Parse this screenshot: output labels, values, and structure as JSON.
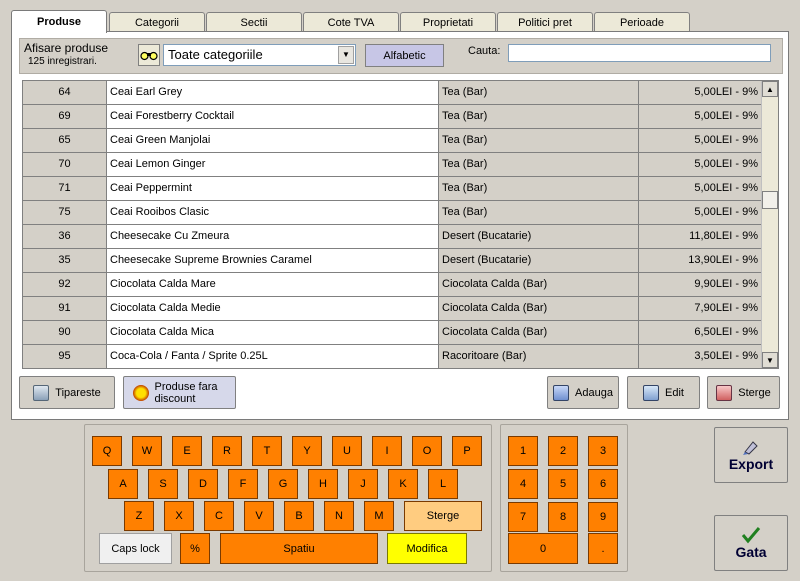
{
  "tabs": [
    "Produse",
    "Categorii",
    "Sectii",
    "Cote TVA",
    "Proprietati",
    "Politici pret",
    "Perioade"
  ],
  "filter": {
    "title": "Afisare produse",
    "count": "125 inregistrari.",
    "category": "Toate categoriile",
    "sort_button": "Alfabetic",
    "search_label": "Cauta:",
    "search_value": ""
  },
  "rows": [
    {
      "id": "64",
      "name": "Ceai Earl Grey",
      "category": "Tea (Bar)",
      "price": "5,00LEI - 9%"
    },
    {
      "id": "69",
      "name": "Ceai Forestberry Cocktail",
      "category": "Tea (Bar)",
      "price": "5,00LEI - 9%"
    },
    {
      "id": "65",
      "name": "Ceai Green Manjolai",
      "category": "Tea (Bar)",
      "price": "5,00LEI - 9%"
    },
    {
      "id": "70",
      "name": "Ceai Lemon Ginger",
      "category": "Tea (Bar)",
      "price": "5,00LEI - 9%"
    },
    {
      "id": "71",
      "name": "Ceai Peppermint",
      "category": "Tea (Bar)",
      "price": "5,00LEI - 9%"
    },
    {
      "id": "75",
      "name": "Ceai Rooibos Clasic",
      "category": "Tea (Bar)",
      "price": "5,00LEI - 9%"
    },
    {
      "id": "36",
      "name": "Cheesecake Cu Zmeura",
      "category": "Desert (Bucatarie)",
      "price": "11,80LEI - 9%"
    },
    {
      "id": "35",
      "name": "Cheesecake Supreme Brownies Caramel",
      "category": "Desert (Bucatarie)",
      "price": "13,90LEI - 9%"
    },
    {
      "id": "92",
      "name": "Ciocolata Calda Mare",
      "category": "Ciocolata Calda (Bar)",
      "price": "9,90LEI - 9%"
    },
    {
      "id": "91",
      "name": "Ciocolata Calda Medie",
      "category": "Ciocolata Calda (Bar)",
      "price": "7,90LEI - 9%"
    },
    {
      "id": "90",
      "name": "Ciocolata Calda Mica",
      "category": "Ciocolata Calda (Bar)",
      "price": "6,50LEI - 9%"
    },
    {
      "id": "95",
      "name": "Coca-Cola / Fanta / Sprite 0.25L",
      "category": "Racoritoare (Bar)",
      "price": "3,50LEI - 9%"
    }
  ],
  "buttons": {
    "print": "Tipareste",
    "no_discount": "Produse fara discount",
    "add": "Adauga",
    "edit": "Edit",
    "delete": "Sterge",
    "export": "Export",
    "done": "Gata"
  },
  "keyboard": {
    "row1": [
      "Q",
      "W",
      "E",
      "R",
      "T",
      "Y",
      "U",
      "I",
      "O",
      "P"
    ],
    "row2": [
      "A",
      "S",
      "D",
      "F",
      "G",
      "H",
      "J",
      "K",
      "L"
    ],
    "row3": [
      "Z",
      "X",
      "C",
      "V",
      "B",
      "N",
      "M"
    ],
    "backspace": "Sterge",
    "caps": "Caps lock",
    "percent": "%",
    "space": "Spatiu",
    "modify": "Modifica"
  },
  "numpad": {
    "keys": [
      "1",
      "2",
      "3",
      "4",
      "5",
      "6",
      "7",
      "8",
      "9"
    ],
    "zero": "0",
    "dot": "."
  },
  "colors": {
    "key": "#ff8000",
    "key_light": "#ffcc80",
    "modify": "#ffff00",
    "sort_button": "#c7c6e6"
  }
}
